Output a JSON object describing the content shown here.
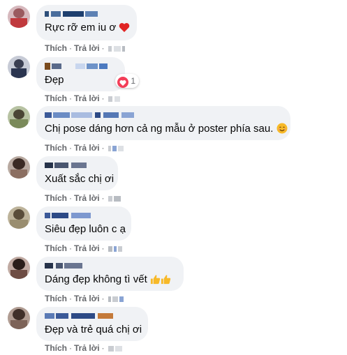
{
  "ui": {
    "like_label": "Thích",
    "reply_label": "Trả lời",
    "separator": "·"
  },
  "comments": [
    {
      "text": "Rực rỡ em iu ơ",
      "emoji": "red-heart"
    },
    {
      "text": "Đẹp",
      "reaction_count": "1"
    },
    {
      "text": "Chị pose dáng hơn cả ng mẫu ở poster phía sau.",
      "emoji": "smiling-face"
    },
    {
      "text": "Xuất sắc chị ơi"
    },
    {
      "text": "Siêu đẹp luôn c ạ"
    },
    {
      "text": "Dáng đẹp không tì vết",
      "emoji": "thumbs-up x2"
    },
    {
      "text": "Đẹp và trẻ quá chị ơi"
    }
  ],
  "colors": {
    "bubble": "#f0f2f5",
    "meta": "#65676b",
    "text": "#050505",
    "heart": "#f33e58",
    "thumb": "#f7b928"
  }
}
